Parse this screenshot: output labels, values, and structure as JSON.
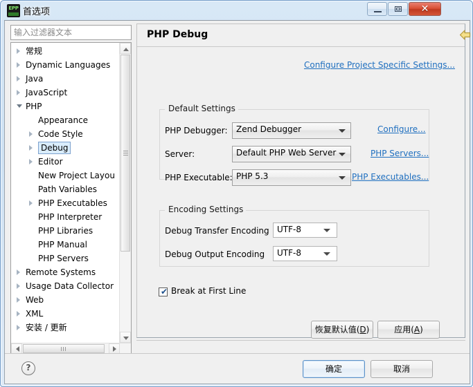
{
  "window": {
    "title": "首选项",
    "app_icon": "epp-icon",
    "icon_label": "EPP",
    "controls": {
      "minimize": "minimize-button",
      "maximize": "maximize-button",
      "close": "✕"
    }
  },
  "sidebar": {
    "filter": {
      "placeholder": "输入过滤器文本",
      "value": ""
    },
    "items": [
      {
        "label": "常规",
        "depth": 0,
        "state": "collapsed"
      },
      {
        "label": "Dynamic Languages",
        "depth": 0,
        "state": "collapsed"
      },
      {
        "label": "Java",
        "depth": 0,
        "state": "collapsed"
      },
      {
        "label": "JavaScript",
        "depth": 0,
        "state": "collapsed"
      },
      {
        "label": "PHP",
        "depth": 0,
        "state": "expanded"
      },
      {
        "label": "Appearance",
        "depth": 1,
        "state": "leaf"
      },
      {
        "label": "Code Style",
        "depth": 1,
        "state": "collapsed"
      },
      {
        "label": "Debug",
        "depth": 1,
        "state": "collapsed",
        "selected": true
      },
      {
        "label": "Editor",
        "depth": 1,
        "state": "collapsed"
      },
      {
        "label": "New Project Layou",
        "depth": 1,
        "state": "leaf"
      },
      {
        "label": "Path Variables",
        "depth": 1,
        "state": "leaf"
      },
      {
        "label": "PHP Executables",
        "depth": 1,
        "state": "collapsed"
      },
      {
        "label": "PHP Interpreter",
        "depth": 1,
        "state": "leaf"
      },
      {
        "label": "PHP Libraries",
        "depth": 1,
        "state": "leaf"
      },
      {
        "label": "PHP Manual",
        "depth": 1,
        "state": "leaf"
      },
      {
        "label": "PHP Servers",
        "depth": 1,
        "state": "leaf"
      },
      {
        "label": "Remote Systems",
        "depth": 0,
        "state": "collapsed"
      },
      {
        "label": "Usage Data Collector",
        "depth": 0,
        "state": "collapsed"
      },
      {
        "label": "Web",
        "depth": 0,
        "state": "collapsed"
      },
      {
        "label": "XML",
        "depth": 0,
        "state": "collapsed"
      },
      {
        "label": "安装 / 更新",
        "depth": 0,
        "state": "collapsed"
      }
    ]
  },
  "page": {
    "title": "PHP Debug",
    "nav": {
      "back": "back-arrow-icon",
      "back_menu": "back-dropdown-caret",
      "forward": "forward-arrow-icon",
      "forward_menu": "forward-dropdown-caret",
      "view_menu": "view-menu-caret"
    },
    "project_specific_link": "Configure Project Specific Settings...",
    "groups": [
      {
        "title": "Default Settings",
        "rows": [
          {
            "label": "PHP Debugger:",
            "value": "Zend Debugger",
            "link": "Configure..."
          },
          {
            "label": "Server:",
            "value": "Default PHP Web Server",
            "link": "PHP Servers..."
          },
          {
            "label": "PHP Executable:",
            "value": "PHP 5.3",
            "link": "PHP Executables..."
          }
        ]
      },
      {
        "title": "Encoding Settings",
        "rows": [
          {
            "label": "Debug Transfer Encoding",
            "value": "UTF-8"
          },
          {
            "label": "Debug Output Encoding",
            "value": "UTF-8"
          }
        ]
      }
    ],
    "checkbox": {
      "label": "Break at First Line",
      "checked": true,
      "mark": "✔"
    },
    "buttons": {
      "restore_defaults": "恢复默认值(D)",
      "restore_defaults_plain": "恢复默认值(",
      "restore_defaults_mnemonic": "D",
      "apply": "应用(A)",
      "apply_plain": "应用(",
      "apply_mnemonic": "A"
    }
  },
  "footer": {
    "help": "?",
    "ok": "确定",
    "cancel": "取消"
  },
  "colors": {
    "link": "#1f6fbf",
    "selection": "#d9ecfb",
    "selection_border": "#7da2ce",
    "dialog_bg": "#f0f0f0",
    "close_red": "#d94f34"
  }
}
